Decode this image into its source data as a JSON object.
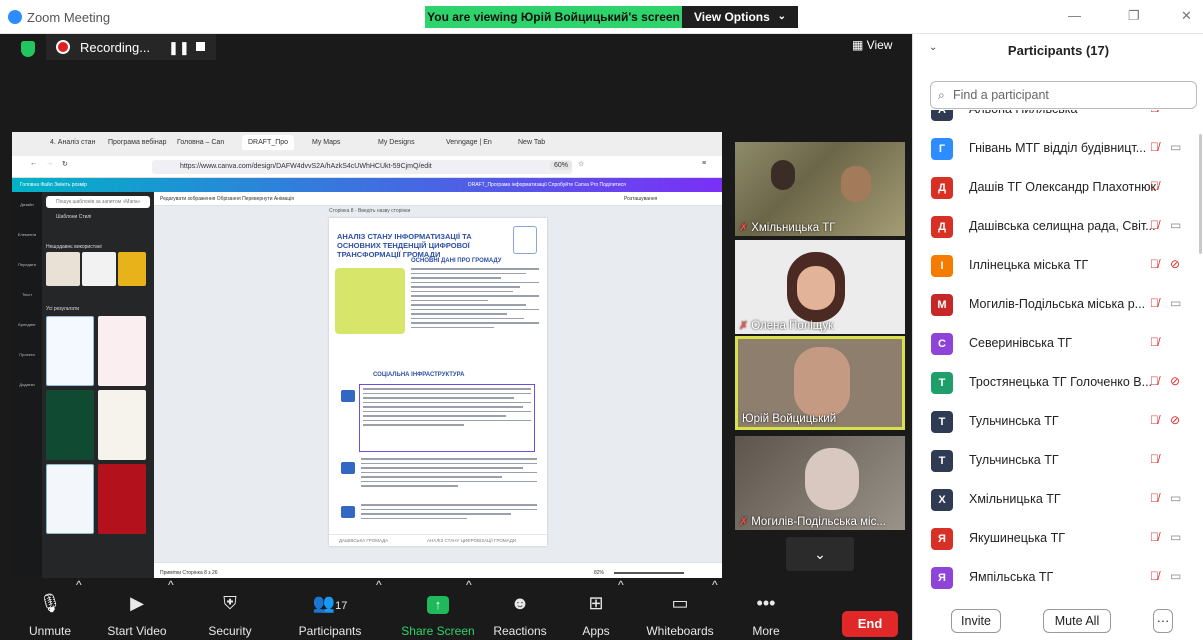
{
  "window": {
    "title": "Zoom Meeting",
    "banner": "You are viewing Юрій Войцицький's screen",
    "view_options": "View Options",
    "chevron": "⌄",
    "minimize": "—",
    "restore": "❐",
    "close": "✕"
  },
  "recording": {
    "label": "Recording...",
    "pause": "❚❚"
  },
  "view_button": "View",
  "shared_screen": {
    "tabs": [
      "4. Аналіз стан",
      "Програма вебінар",
      "Головна – Can",
      "DRAFT_Про",
      "My Maps",
      "My Designs",
      "Venngage | En",
      "New Tab"
    ],
    "url": "https://www.canva.com/design/DAFW4dvvS2A/hAzkS4cUWhHCUkt-59CjmQ/edit",
    "zoom": "60%",
    "canva_top_left": "Головна    Файл    Змініть розмір",
    "canva_top_right": "DRAFT_Програма інформатизації    Спробуйте Canva Pro    Поділитися",
    "sidebar": [
      "Дизайн",
      "Елементи",
      "Передати",
      "Текст",
      "Брендинг",
      "Проекти",
      "Додатки"
    ],
    "panel_search": "Пошук шаблонів за запитом «Мапа»",
    "panel_tabs": "Шаблони     Стилі",
    "panel_recent": "Нещодавнє використані",
    "panel_results": "Усі результати",
    "toolbar": "Редагувати зображення    Обрізання    Перевернути    Анімація",
    "toolbar_right": "Розташування",
    "doc": {
      "page_label": "Сторінка 8 - Введіть назву сторінки",
      "title": "АНАЛІЗ СТАНУ ІНФОРМАТИЗАЦІЇ ТА ОСНОВНИХ ТЕНДЕНЦІЙ ЦИФРОВОЇ ТРАНСФОРМАЦІЇ ГРОМАДИ",
      "basic_heading": "ОСНОВНІ ДАНІ ПРО ГРОМАДУ",
      "social_heading": "СОЦІАЛЬНА ІНФРАСТРУКТУРА",
      "footer_left": "ДАШІВСЬКА ГРОМАДА",
      "footer_right": "АНАЛІЗ СТАНУ ЦИФРОВІЗАЦІЇ ГРОМАДИ"
    },
    "status_left": "Примітки    Сторінка 8 з 26",
    "status_zoom": "82%"
  },
  "video_tiles": [
    {
      "name": "Хмільницька ТГ",
      "muted": true
    },
    {
      "name": "Олена Поліщук",
      "muted": true
    },
    {
      "name": "Юрій Войцицький",
      "muted": false
    },
    {
      "name": "Могилів-Подільська міс...",
      "muted": true
    }
  ],
  "toolbar": {
    "unmute": "Unmute",
    "start_video": "Start Video",
    "security": "Security",
    "participants": "Participants",
    "participants_count": "17",
    "share_screen": "Share Screen",
    "reactions": "Reactions",
    "apps": "Apps",
    "whiteboards": "Whiteboards",
    "more": "More",
    "end": "End",
    "caret": "^"
  },
  "participants_panel": {
    "title": "Participants (17)",
    "search_placeholder": "Find a participant",
    "invite": "Invite",
    "mute_all": "Mute All",
    "more": "···",
    "participants": [
      {
        "initial": "А",
        "name": "Альона Пилявська",
        "color": "#2f3b52",
        "mic": "muted",
        "cam": "none"
      },
      {
        "initial": "Г",
        "name": "Гнівань МТГ відділ будівницт...",
        "color": "#2d8cff",
        "mic": "muted",
        "cam": "on"
      },
      {
        "initial": "Д",
        "name": "Дашів ТГ Олександр Плахотнюк",
        "color": "#d93025",
        "mic": "muted",
        "cam": "none"
      },
      {
        "initial": "Д",
        "name": "Дашівська селищна рада, Світ...",
        "color": "#d93025",
        "mic": "muted",
        "cam": "on"
      },
      {
        "initial": "І",
        "name": "Іллінецька міська ТГ",
        "color": "#f57c00",
        "mic": "muted",
        "cam": "off"
      },
      {
        "initial": "М",
        "name": "Могилів-Подільська міська р...",
        "color": "#c62828",
        "mic": "muted",
        "cam": "on"
      },
      {
        "initial": "С",
        "name": "Северинівська ТГ",
        "color": "#8e44d8",
        "mic": "muted",
        "cam": "none"
      },
      {
        "initial": "Т",
        "name": "Тростянецька ТГ Голоченко В...",
        "color": "#1e9e6a",
        "mic": "muted",
        "cam": "off"
      },
      {
        "initial": "Т",
        "name": "Тульчинська ТГ",
        "color": "#2f3b52",
        "mic": "muted",
        "cam": "off"
      },
      {
        "initial": "Т",
        "name": "Тульчинська ТГ",
        "color": "#2f3b52",
        "mic": "muted",
        "cam": "none"
      },
      {
        "initial": "Х",
        "name": "Хмільницька ТГ",
        "color": "#2f3b52",
        "mic": "muted",
        "cam": "on"
      },
      {
        "initial": "Я",
        "name": "Якушинецька ТГ",
        "color": "#d93025",
        "mic": "muted",
        "cam": "on"
      },
      {
        "initial": "Я",
        "name": "Ямпільська ТГ",
        "color": "#8e44d8",
        "mic": "muted",
        "cam": "on"
      }
    ]
  }
}
